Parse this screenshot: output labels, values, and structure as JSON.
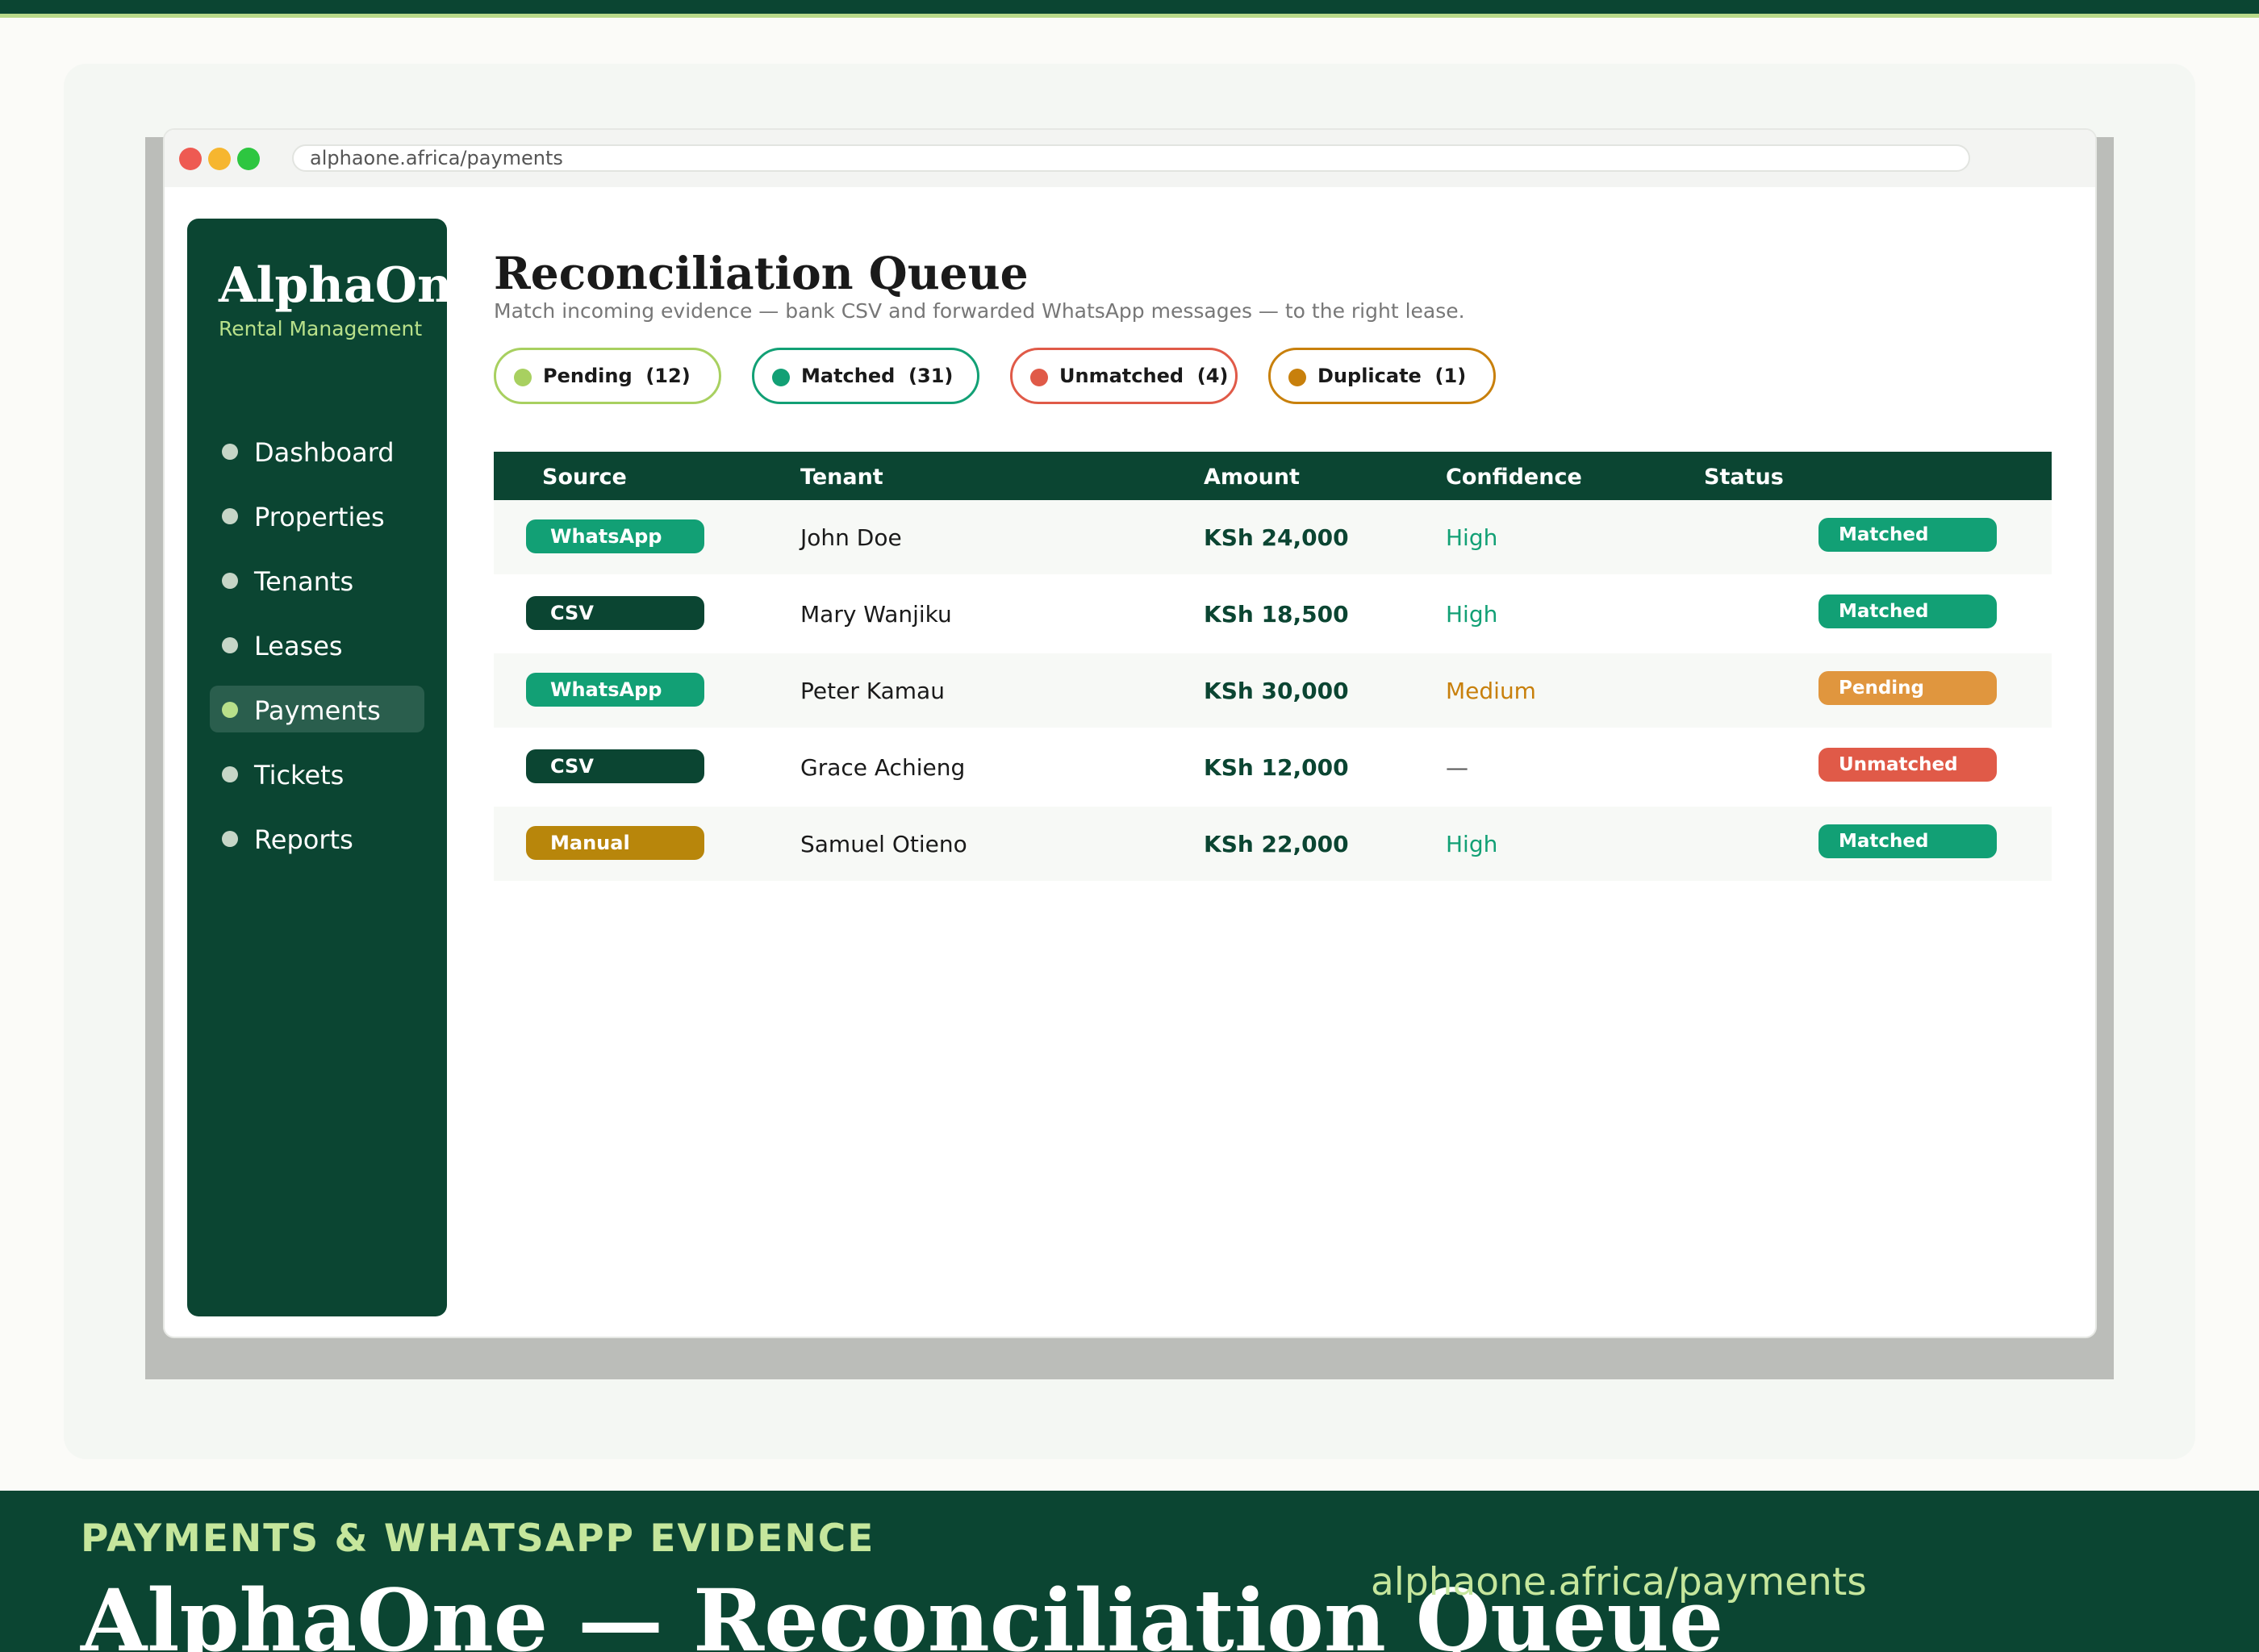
{
  "browser": {
    "url": "alphaone.africa/payments"
  },
  "sidebar": {
    "brand": "AlphaOne",
    "subtitle": "Rental Management",
    "items": [
      {
        "label": "Dashboard",
        "active": false
      },
      {
        "label": "Properties",
        "active": false
      },
      {
        "label": "Tenants",
        "active": false
      },
      {
        "label": "Leases",
        "active": false
      },
      {
        "label": "Payments",
        "active": true
      },
      {
        "label": "Tickets",
        "active": false
      },
      {
        "label": "Reports",
        "active": false
      }
    ]
  },
  "main": {
    "title": "Reconciliation Queue",
    "subtitle": "Match incoming evidence — bank CSV and forwarded WhatsApp messages — to the right lease.",
    "filters": [
      {
        "label": "Pending",
        "count": "(12)",
        "text": "Pending  (12)",
        "color": "#a8d060"
      },
      {
        "label": "Matched",
        "count": "(31)",
        "text": "Matched  (31)",
        "color": "#12a075"
      },
      {
        "label": "Unmatched",
        "count": "(4)",
        "text": "Unmatched  (4)",
        "color": "#e05a48"
      },
      {
        "label": "Duplicate",
        "count": "(1)",
        "text": "Duplicate  (1)",
        "color": "#c8800c"
      }
    ],
    "table": {
      "columns": [
        "Source",
        "Tenant",
        "Amount",
        "Confidence",
        "Status"
      ],
      "rows": [
        {
          "source": "WhatsApp",
          "tenant": "John Doe",
          "amount": "KSh 24,000",
          "confidence": "High",
          "status": "Matched"
        },
        {
          "source": "CSV",
          "tenant": "Mary Wanjiku",
          "amount": "KSh 18,500",
          "confidence": "High",
          "status": "Matched"
        },
        {
          "source": "WhatsApp",
          "tenant": "Peter Kamau",
          "amount": "KSh 30,000",
          "confidence": "Medium",
          "status": "Pending"
        },
        {
          "source": "CSV",
          "tenant": "Grace Achieng",
          "amount": "KSh 12,000",
          "confidence": "—",
          "status": "Unmatched"
        },
        {
          "source": "Manual",
          "tenant": "Samuel Otieno",
          "amount": "KSh 22,000",
          "confidence": "High",
          "status": "Matched"
        }
      ]
    }
  },
  "footer": {
    "kicker": "PAYMENTS & WHATSAPP EVIDENCE",
    "title": "AlphaOne — Reconciliation Queue",
    "url": "alphaone.africa/payments"
  },
  "colors": {
    "brand_dark": "#0b4532",
    "accent_green": "#12a075",
    "accent_light": "#b8e08a",
    "source_whatsapp": "#12a075",
    "source_csv": "#0b4532",
    "source_manual": "#b8860b",
    "status_matched": "#12a075",
    "status_pending": "#e0963e",
    "status_unmatched": "#e05a48",
    "confidence_high": "#12a075",
    "confidence_medium": "#c8800c",
    "confidence_none": "#555555"
  }
}
